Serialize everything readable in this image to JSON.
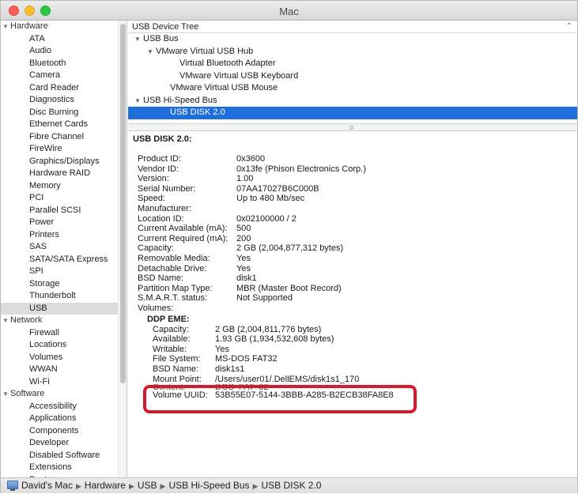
{
  "window": {
    "title": "Mac"
  },
  "sidebar": {
    "groups": [
      {
        "label": "Hardware",
        "items": [
          "ATA",
          "Audio",
          "Bluetooth",
          "Camera",
          "Card Reader",
          "Diagnostics",
          "Disc Burning",
          "Ethernet Cards",
          "Fibre Channel",
          "FireWire",
          "Graphics/Displays",
          "Hardware RAID",
          "Memory",
          "PCI",
          "Parallel SCSI",
          "Power",
          "Printers",
          "SAS",
          "SATA/SATA Express",
          "SPI",
          "Storage",
          "Thunderbolt",
          "USB"
        ]
      },
      {
        "label": "Network",
        "items": [
          "Firewall",
          "Locations",
          "Volumes",
          "WWAN",
          "Wi-Fi"
        ]
      },
      {
        "label": "Software",
        "items": [
          "Accessibility",
          "Applications",
          "Components",
          "Developer",
          "Disabled Software",
          "Extensions",
          "Fonts"
        ]
      }
    ],
    "selected": "USB"
  },
  "tree": {
    "header": "USB Device Tree",
    "rows": [
      {
        "label": "USB Bus",
        "level": 0,
        "expanded": true
      },
      {
        "label": "VMware Virtual USB Hub",
        "level": 1,
        "expanded": true
      },
      {
        "label": "Virtual Bluetooth Adapter",
        "level": 2
      },
      {
        "label": "VMware Virtual USB Keyboard",
        "level": 2
      },
      {
        "label": "VMware Virtual USB Mouse",
        "level": 1
      },
      {
        "label": "USB Hi-Speed Bus",
        "level": 0,
        "expanded": true
      },
      {
        "label": "USB DISK 2.0",
        "level": 1,
        "selected": true
      }
    ]
  },
  "detail": {
    "title": "USB DISK 2.0:",
    "properties": [
      {
        "key": "Product ID:",
        "value": "0x3600"
      },
      {
        "key": "Vendor ID:",
        "value": "0x13fe  (Phison Electronics Corp.)"
      },
      {
        "key": "Version:",
        "value": "1.00"
      },
      {
        "key": "Serial Number:",
        "value": "07AA17027B6C000B"
      },
      {
        "key": "Speed:",
        "value": "Up to 480 Mb/sec"
      },
      {
        "key": "Manufacturer:",
        "value": ""
      },
      {
        "key": "Location ID:",
        "value": "0x02100000 / 2"
      },
      {
        "key": "Current Available (mA):",
        "value": "500"
      },
      {
        "key": "Current Required (mA):",
        "value": "200"
      },
      {
        "key": "Capacity:",
        "value": "2 GB (2,004,877,312 bytes)"
      },
      {
        "key": "Removable Media:",
        "value": "Yes"
      },
      {
        "key": "Detachable Drive:",
        "value": "Yes"
      },
      {
        "key": "BSD Name:",
        "value": "disk1"
      },
      {
        "key": "Partition Map Type:",
        "value": "MBR (Master Boot Record)"
      },
      {
        "key": "S.M.A.R.T. status:",
        "value": "Not Supported"
      },
      {
        "key": "Volumes:",
        "value": ""
      }
    ],
    "volume": {
      "name": "DDP EME:",
      "properties": [
        {
          "key": "Capacity:",
          "value": "2 GB (2,004,811,776 bytes)"
        },
        {
          "key": "Available:",
          "value": "1.93 GB (1,934,532,608 bytes)"
        },
        {
          "key": "Writable:",
          "value": "Yes"
        },
        {
          "key": "File System:",
          "value": "MS-DOS FAT32"
        },
        {
          "key": "BSD Name:",
          "value": "disk1s1"
        },
        {
          "key": "Mount Point:",
          "value": "/Users/user01/.DellEMS/disk1s1_170"
        },
        {
          "key": "Content:",
          "value": "DOS_FAT_32"
        },
        {
          "key": "Volume UUID:",
          "value": "53B55E07-5144-3BBB-A285-B2ECB38FA8E8"
        }
      ]
    }
  },
  "statusbar": {
    "crumbs": [
      "David's Mac",
      "Hardware",
      "USB",
      "USB Hi-Speed Bus",
      "USB DISK 2.0"
    ]
  },
  "colors": {
    "selection": "#1e6fdb",
    "highlight_box": "#d7192a"
  }
}
